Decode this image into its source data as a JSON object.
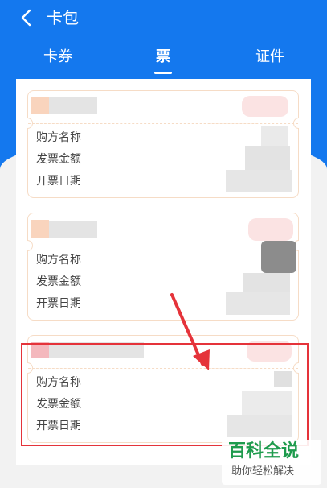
{
  "header": {
    "title": "卡包"
  },
  "tabs": [
    {
      "label": "卡券",
      "active": false
    },
    {
      "label": "票",
      "active": true
    },
    {
      "label": "证件",
      "active": false
    }
  ],
  "tickets": [
    {
      "fields": [
        "购方名称",
        "发票金额",
        "开票日期"
      ]
    },
    {
      "fields": [
        "购方名称",
        "发票金额",
        "开票日期"
      ]
    },
    {
      "fields": [
        "购方名称",
        "发票金额",
        "开票日期"
      ]
    }
  ],
  "watermark": {
    "main": "百科全说",
    "sub": "助你轻松解决"
  },
  "colors": {
    "header_blue": "#1478ee",
    "highlight_red": "#e5333a",
    "watermark_green": "#1e9b4d"
  }
}
